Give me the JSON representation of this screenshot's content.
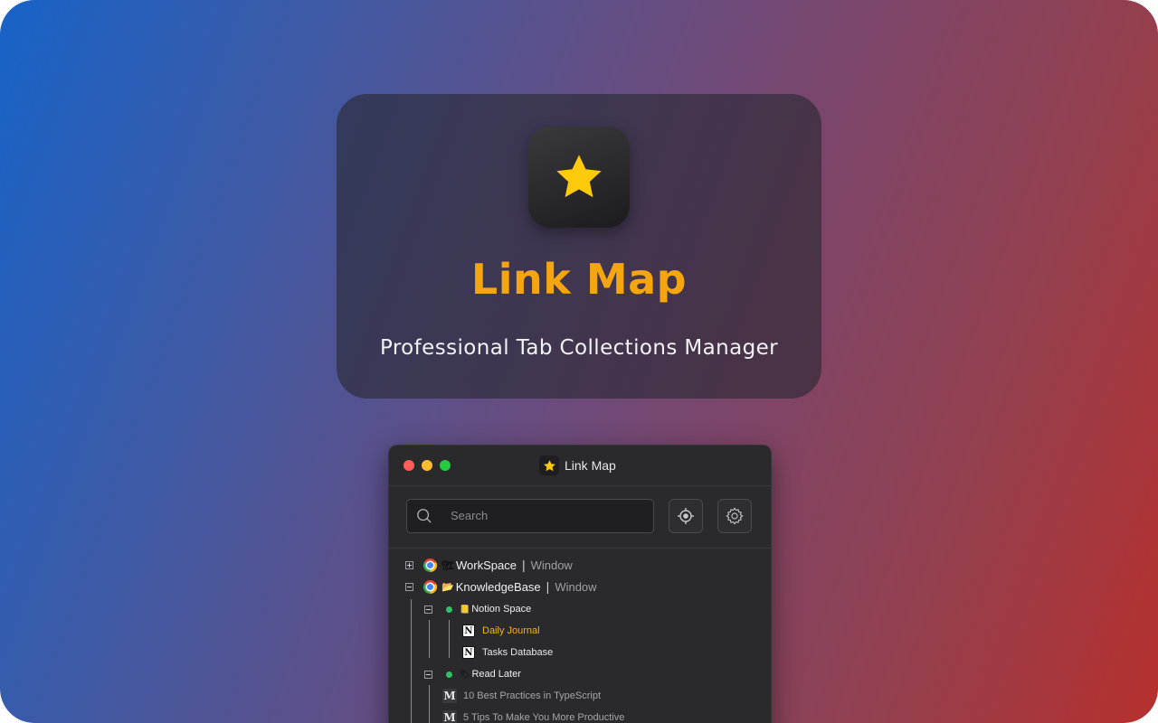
{
  "hero": {
    "title": "Link Map",
    "subtitle": "Professional Tab Collections Manager",
    "icon": "star-icon",
    "accent_color": "#f5a50f"
  },
  "window": {
    "title": "Link Map",
    "controls": [
      "close",
      "minimize",
      "zoom"
    ],
    "search": {
      "placeholder": "Search",
      "value": ""
    },
    "buttons": {
      "locate": "locate-icon",
      "settings": "gear-icon"
    }
  },
  "tree": {
    "windows": [
      {
        "name": "WorkSpace",
        "kind": "Window",
        "expanded": false,
        "emoji": "🏗"
      },
      {
        "name": "KnowledgeBase",
        "kind": "Window",
        "expanded": true,
        "emoji": "📂"
      }
    ],
    "groups": [
      {
        "name": "Notion Space",
        "emoji": "📒"
      },
      {
        "name": "Read Later",
        "emoji": "🏷"
      }
    ],
    "tabs": [
      {
        "title": "Daily Journal",
        "favicon": "notion-icon",
        "active": true
      },
      {
        "title": "Tasks Database",
        "favicon": "notion-icon",
        "active": false
      },
      {
        "title": "10 Best Practices in TypeScript",
        "favicon": "medium-icon",
        "active": false
      },
      {
        "title": "5 Tips To Make You More Productive",
        "favicon": "medium-icon",
        "active": false
      }
    ]
  }
}
